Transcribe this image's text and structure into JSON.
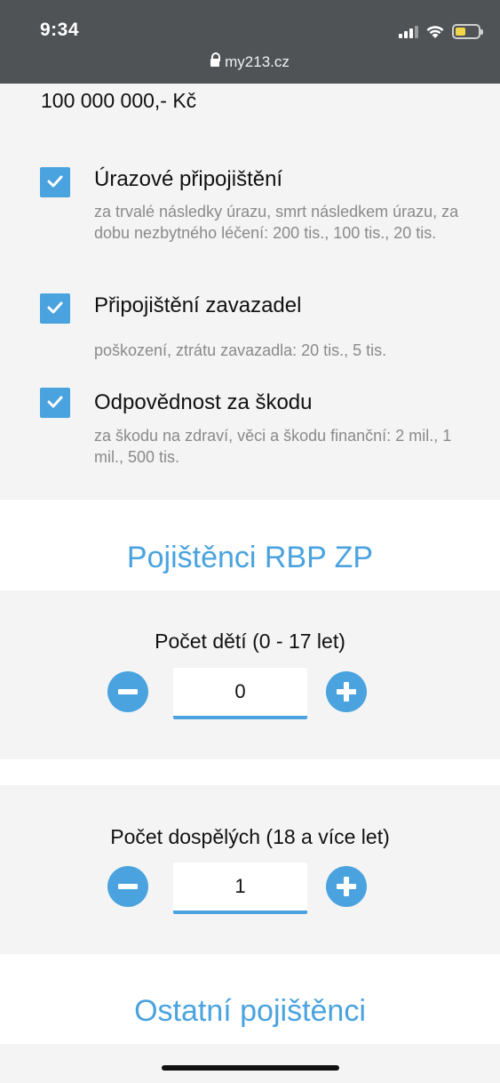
{
  "status_bar": {
    "time": "9:34",
    "url": "my213.cz",
    "icons": [
      "signal-icon",
      "wifi-icon",
      "battery-icon"
    ],
    "battery_color": "#f3d54a"
  },
  "coverage": {
    "amount": "100 000 000,- Kč",
    "options": [
      {
        "title": "Úrazové připojištění",
        "description": "za trvalé následky úrazu, smrt následkem úrazu, za dobu nezbytného léčení: 200 tis., 100 tis., 20 tis.",
        "checked": true
      },
      {
        "title": "Připojištění zavazadel",
        "description": "poškození, ztrátu zavazadla: 20 tis., 5 tis.",
        "checked": true
      },
      {
        "title": "Odpovědnost za škodu",
        "description": "za škodu na zdraví, věci a škodu finanční: 2 mil., 1 mil., 500 tis.",
        "checked": true
      }
    ]
  },
  "insured_rbp": {
    "heading": "Pojištěnci RBP ZP",
    "children": {
      "label": "Počet dětí (0 - 17 let)",
      "value": "0"
    },
    "adults": {
      "label": "Počet dospělých (18 a více let)",
      "value": "1"
    }
  },
  "other_insured": {
    "heading": "Ostatní pojištěnci"
  },
  "colors": {
    "accent": "#4aa3de",
    "section_bg": "#f4f4f4",
    "topbar_bg": "#4f5356",
    "muted_text": "#8a8a8a"
  }
}
